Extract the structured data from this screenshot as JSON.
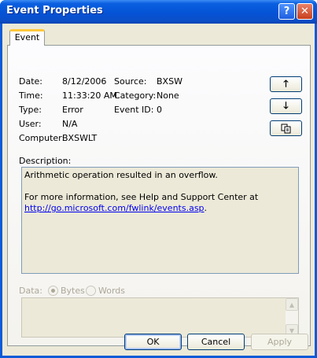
{
  "window": {
    "title": "Event Properties",
    "help_glyph": "?",
    "close_glyph": "✕"
  },
  "tab": {
    "label": "Event"
  },
  "fields": {
    "date_label": "Date:",
    "date_value": "8/12/2006",
    "time_label": "Time:",
    "time_value": "11:33:20 AM",
    "type_label": "Type:",
    "type_value": "Error",
    "user_label": "User:",
    "user_value": "N/A",
    "computer_label": "Computer:",
    "computer_value": "BXSWLT",
    "source_label": "Source:",
    "source_value": "BXSW",
    "category_label": "Category:",
    "category_value": "None",
    "eventid_label": "Event ID:",
    "eventid_value": "0"
  },
  "nav": {
    "up_glyph": "🡑",
    "down_glyph": "🡓"
  },
  "description": {
    "label": "Description:",
    "line1": "Arithmetic operation resulted in an overflow.",
    "line2": "For more information, see Help and Support Center at",
    "link": "http://go.microsoft.com/fwlink/events.asp",
    "link_suffix": "."
  },
  "data_section": {
    "label": "Data:",
    "bytes_label": "Bytes",
    "words_label": "Words",
    "selected": "Bytes"
  },
  "buttons": {
    "ok": "OK",
    "cancel": "Cancel",
    "apply": "Apply"
  }
}
